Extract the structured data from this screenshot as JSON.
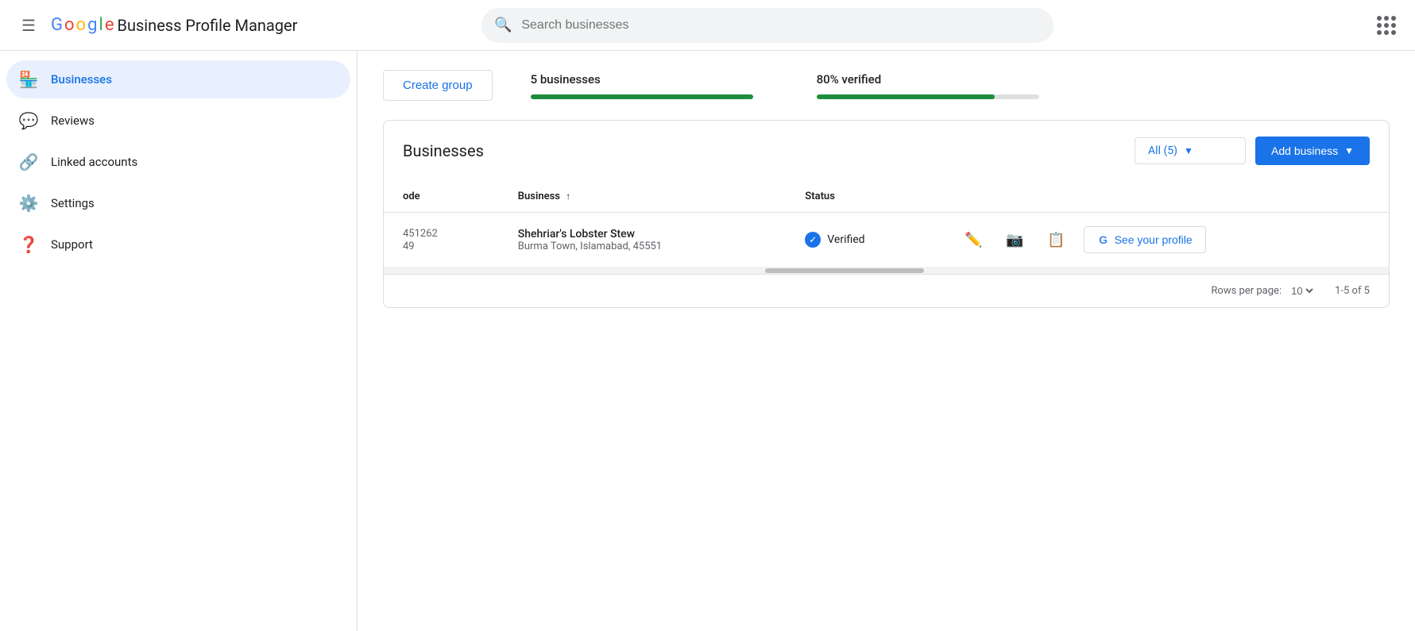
{
  "header": {
    "menu_label": "Main menu",
    "google_text": "Google",
    "app_title": "Business Profile Manager",
    "search_placeholder": "Search businesses",
    "apps_icon_label": "Google apps"
  },
  "sidebar": {
    "items": [
      {
        "id": "businesses",
        "label": "Businesses",
        "icon": "🏪",
        "active": true
      },
      {
        "id": "reviews",
        "label": "Reviews",
        "icon": "💬",
        "active": false
      },
      {
        "id": "linked-accounts",
        "label": "Linked accounts",
        "icon": "🔗",
        "active": false
      },
      {
        "id": "settings",
        "label": "Settings",
        "icon": "⚙️",
        "active": false
      },
      {
        "id": "support",
        "label": "Support",
        "icon": "❓",
        "active": false
      }
    ]
  },
  "main": {
    "create_group_label": "Create group",
    "stats": {
      "businesses_count": "5 businesses",
      "verified_label": "80% verified",
      "progress_percent": 80
    },
    "businesses_card": {
      "title": "Businesses",
      "filter_label": "All (5)",
      "add_business_label": "Add business",
      "table": {
        "columns": [
          "ode",
          "Business",
          "Status"
        ],
        "rows": [
          {
            "code": "451262\n49",
            "business_name": "Shehriar's Lobster Stew",
            "business_address": "Burma Town, Islamabad, 45551",
            "status": "Verified"
          }
        ]
      },
      "footer": {
        "rows_per_page_label": "Rows per page:",
        "rows_per_page_value": "10",
        "pagination": "1-5 of 5"
      }
    },
    "see_profile_label": "See your profile"
  }
}
